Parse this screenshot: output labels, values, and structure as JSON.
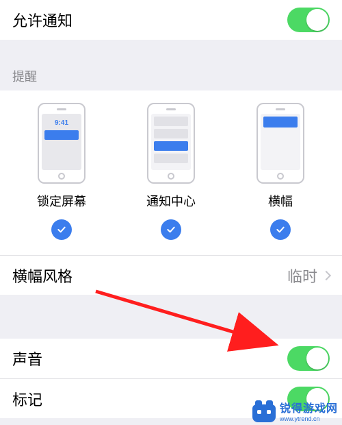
{
  "allow": {
    "label": "允许通知",
    "enabled": true
  },
  "alerts_header": "提醒",
  "previews": {
    "lock": {
      "label": "锁定屏幕",
      "time": "9:41",
      "checked": true
    },
    "center": {
      "label": "通知中心",
      "checked": true
    },
    "banner": {
      "label": "横幅",
      "checked": true
    }
  },
  "banner_style": {
    "label": "横幅风格",
    "value": "临时"
  },
  "sound": {
    "label": "声音",
    "enabled": true
  },
  "badge": {
    "label": "标记",
    "enabled": true
  },
  "watermark": {
    "cn": "锐得游戏网",
    "en": "www.ytrend.cn"
  },
  "colors": {
    "accent": "#3b7ded",
    "toggle_on": "#4cd964",
    "arrow": "#ff1e1e"
  }
}
